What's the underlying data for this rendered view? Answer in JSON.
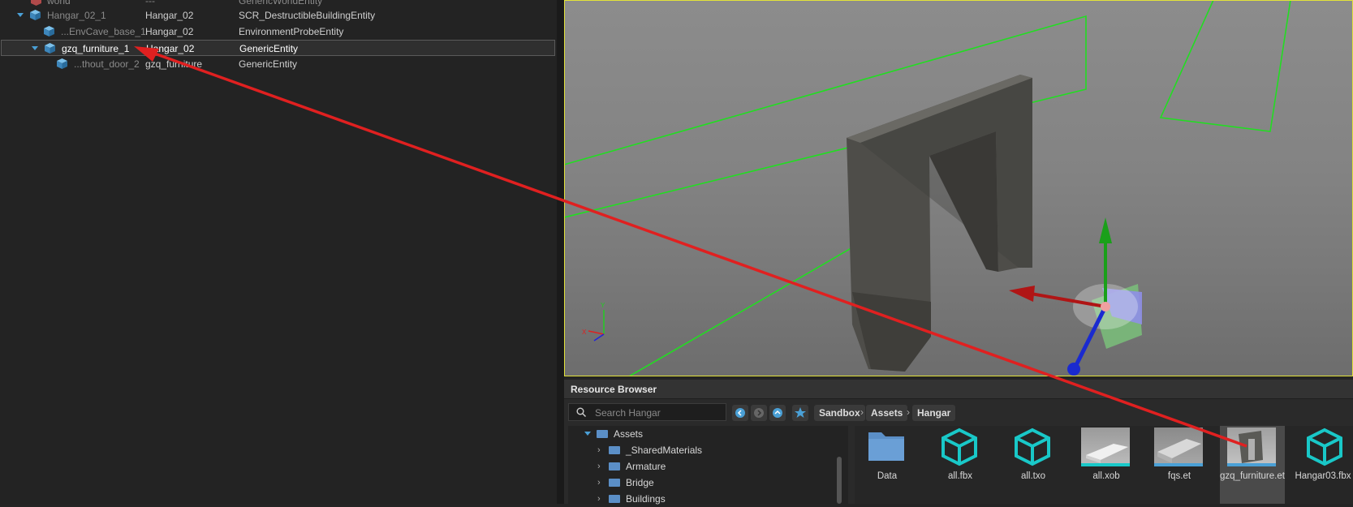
{
  "outliner": {
    "rows": [
      {
        "name": "world",
        "prefab": "---",
        "cls": "GenericWorldEntity"
      },
      {
        "name": "Hangar_02_1",
        "prefab": "Hangar_02",
        "cls": "SCR_DestructibleBuildingEntity"
      },
      {
        "name": "...EnvCave_base_1",
        "prefab": "Hangar_02",
        "cls": "EnvironmentProbeEntity"
      },
      {
        "name": "gzq_furniture_1",
        "prefab": "Hangar_02",
        "cls": "GenericEntity"
      },
      {
        "name": "...thout_door_2",
        "prefab": "gzq_furniture",
        "cls": "GenericEntity"
      }
    ]
  },
  "viewport": {
    "axis_y": "Y",
    "axis_x": "X"
  },
  "resource_browser": {
    "title": "Resource Browser",
    "search_placeholder": "Search Hangar",
    "breadcrumbs": [
      "Sandbox",
      "Assets",
      "Hangar"
    ],
    "tree": [
      {
        "label": "Assets"
      },
      {
        "label": "_SharedMaterials"
      },
      {
        "label": "Armature"
      },
      {
        "label": "Bridge"
      },
      {
        "label": "Buildings"
      }
    ],
    "assets": [
      {
        "label": "Data"
      },
      {
        "label": "all.fbx"
      },
      {
        "label": "all.txo"
      },
      {
        "label": "all.xob"
      },
      {
        "label": "fqs.et"
      },
      {
        "label": "gzq_furniture.et"
      },
      {
        "label": "Hangar03.fbx"
      }
    ]
  },
  "colors": {
    "accent_blue": "#4aa0d6",
    "selection_outline": "#e2e23a",
    "bbox_green": "#22dd22",
    "annotation_red": "#e02020"
  }
}
